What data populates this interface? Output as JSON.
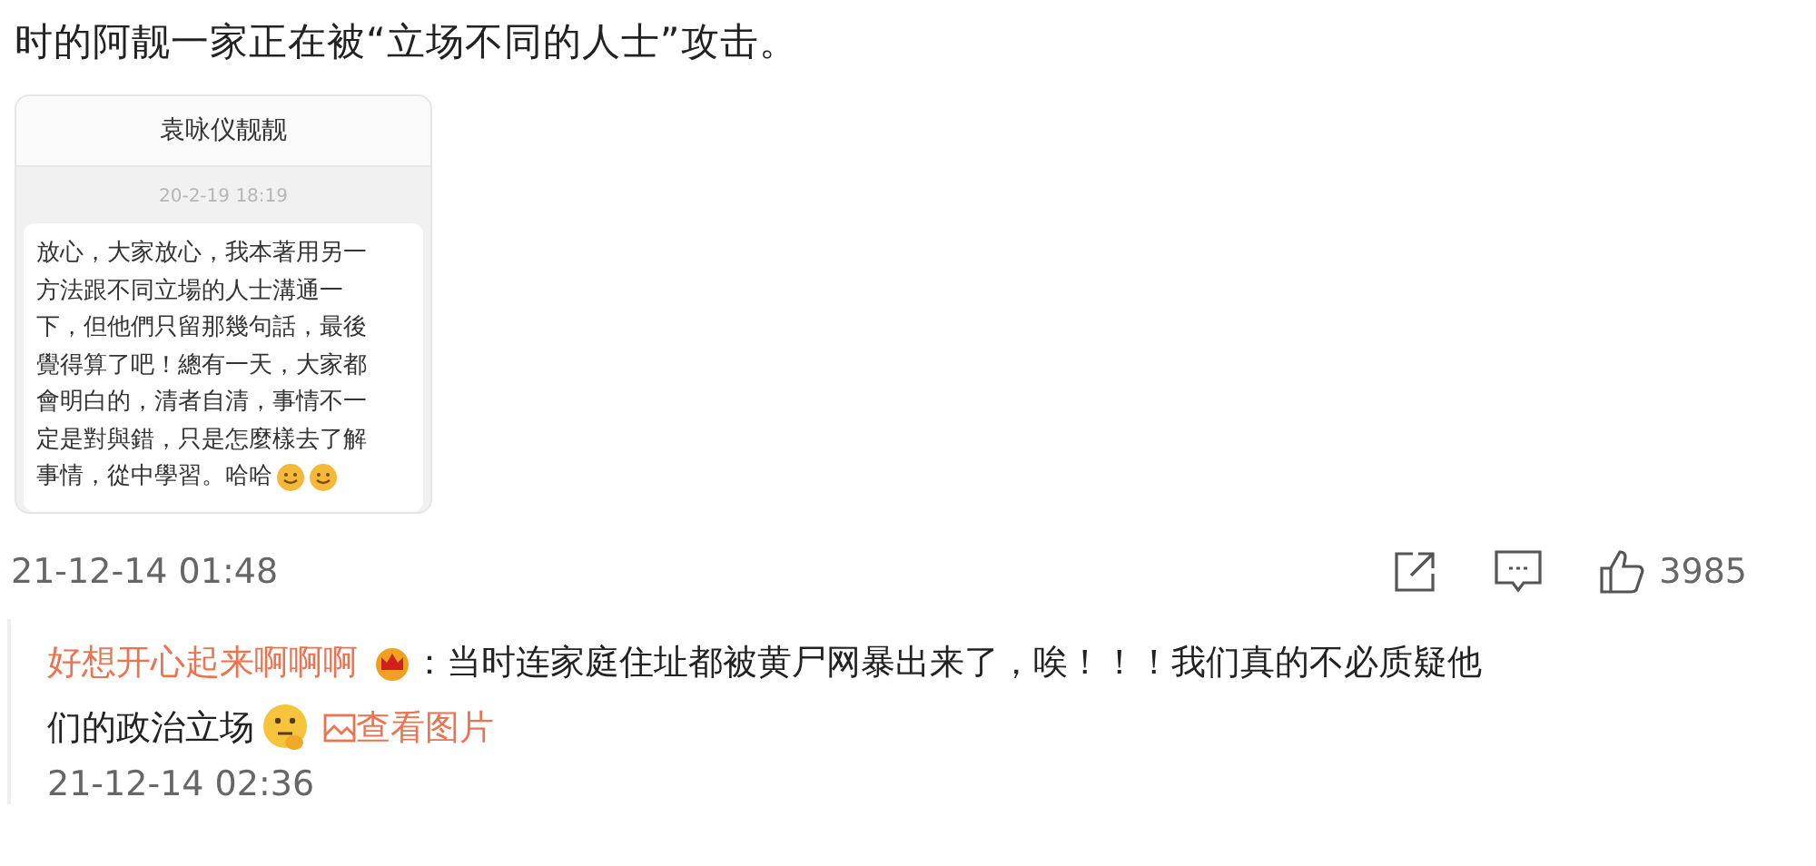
{
  "post": {
    "text": "时的阿靓一家正在被“立场不同的人士”攻击。",
    "screenshot": {
      "name": "袁咏仪靓靓",
      "timestamp": "20-2-19 18:19",
      "message_lines": [
        "放心，大家放心，我本著用另一",
        "方法跟不同立場的人士溝通一",
        "下，但他們只留那幾句話，最後",
        "覺得算了吧！總有一天，大家都",
        "會明白的，清者自清，事情不一",
        "定是對與錯，只是怎麼樣去了解",
        "事情，從中學習。哈哈"
      ]
    },
    "time": "21-12-14 01:48",
    "likes": "3985"
  },
  "reply": {
    "author": "好想开心起来啊啊啊",
    "text_lines": [
      "：当时连家庭住址都被黄尸网暴出来了，唉！！！我们真的不必质疑他",
      "们的政治立场"
    ],
    "view_image": "查看图片",
    "time": "21-12-14 02:36"
  }
}
